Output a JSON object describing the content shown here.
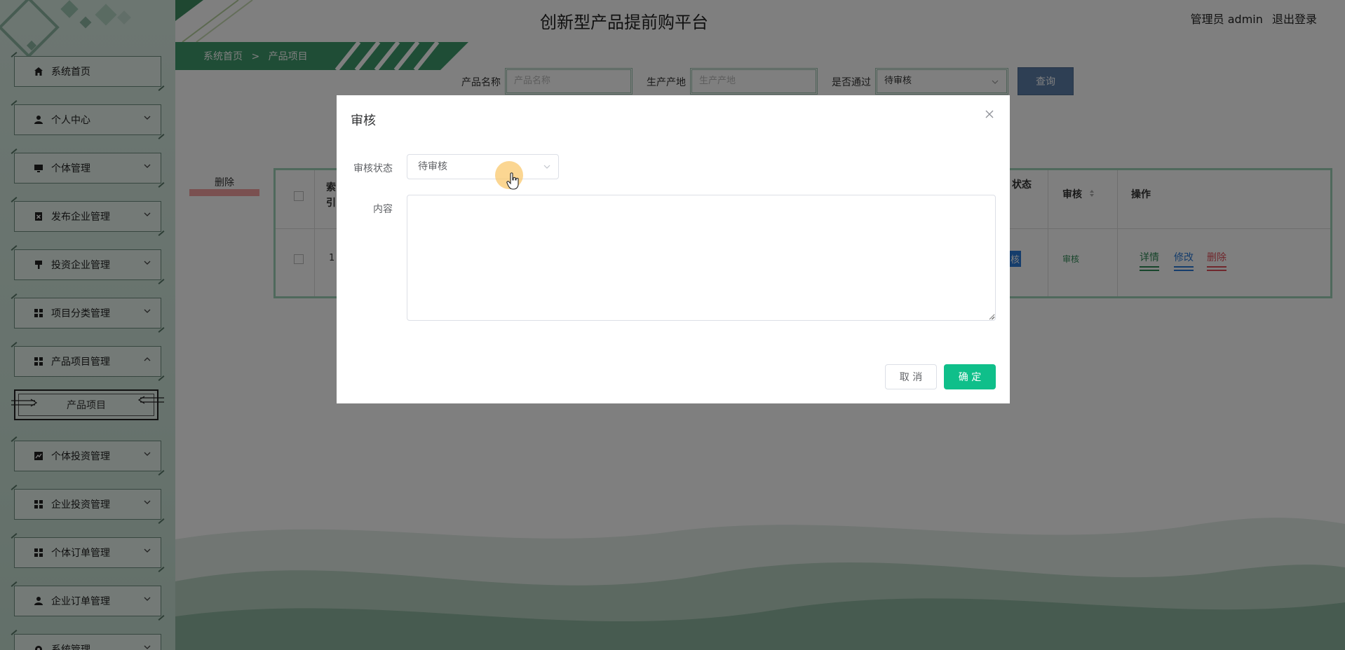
{
  "header": {
    "title": "创新型产品提前购平台",
    "user_label": "管理员 admin",
    "logout_label": "退出登录"
  },
  "breadcrumb": {
    "home": "系统首页",
    "separator": ">",
    "current": "产品项目"
  },
  "sidebar": {
    "items": [
      {
        "label": "系统首页",
        "icon": "home-icon"
      },
      {
        "label": "个人中心",
        "icon": "user-icon"
      },
      {
        "label": "个体管理",
        "icon": "monitor-icon"
      },
      {
        "label": "发布企业管理",
        "icon": "clipboard-icon"
      },
      {
        "label": "投资企业管理",
        "icon": "brush-icon"
      },
      {
        "label": "项目分类管理",
        "icon": "grid-icon"
      },
      {
        "label": "产品项目管理",
        "icon": "grid-icon"
      },
      {
        "label": "个体投资管理",
        "icon": "chart-icon"
      },
      {
        "label": "企业投资管理",
        "icon": "grid-icon"
      },
      {
        "label": "个体订单管理",
        "icon": "grid-icon"
      },
      {
        "label": "企业订单管理",
        "icon": "user-icon"
      },
      {
        "label": "系统管理",
        "icon": "gear-icon"
      }
    ],
    "sub_item": "产品项目"
  },
  "search": {
    "name_label": "产品名称",
    "name_placeholder": "产品名称",
    "origin_label": "生产产地",
    "origin_placeholder": "生产产地",
    "passed_label": "是否通过",
    "passed_value": "待审核",
    "query_label": "查询"
  },
  "table": {
    "delete_label": "删除",
    "index_header_1": "索",
    "index_header_2": "引",
    "status_header": "状态",
    "review_header": "审核",
    "action_header": "操作",
    "row_index": "1",
    "row_status_badge": "核",
    "row_review": "审核",
    "action_detail": "详情",
    "action_edit": "修改",
    "action_delete": "删除"
  },
  "dialog": {
    "title": "审核",
    "status_label": "审核状态",
    "status_value": "待审核",
    "content_label": "内容",
    "cancel_label": "取 消",
    "ok_label": "确 定"
  },
  "colors": {
    "primary": "#0fbf8a",
    "sidebar_bg": "#d9ece3",
    "query_btn": "#5c7ea8",
    "detail_link": "#2e8b57",
    "edit_link": "#2b7bd8",
    "delete_link": "#e0505a"
  }
}
